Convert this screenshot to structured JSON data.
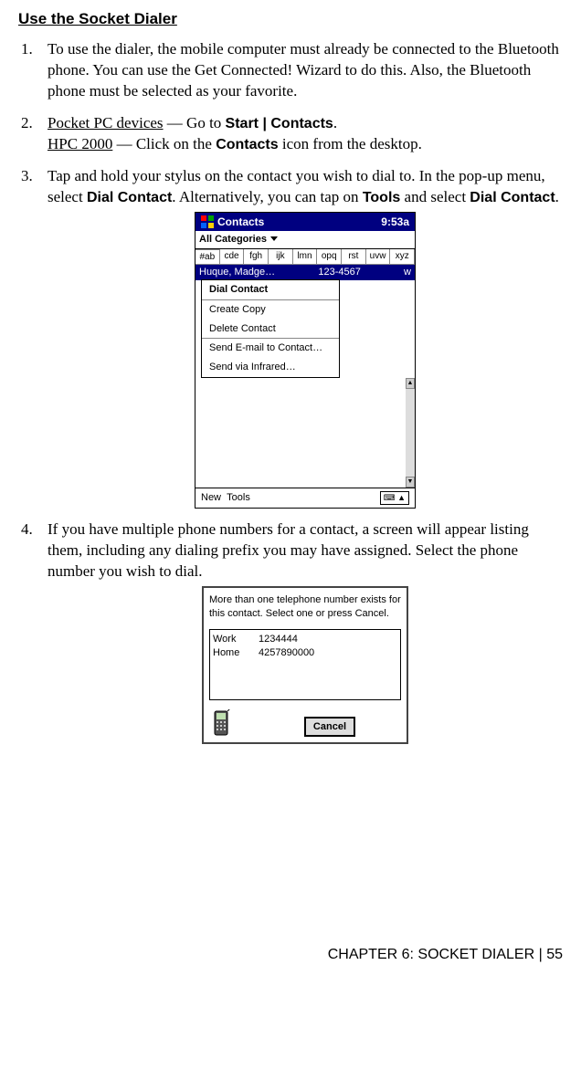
{
  "section_title": "Use the Socket Dialer",
  "steps": {
    "s1": "To use the dialer, the mobile computer must already be connected to the Bluetooth phone. You can use the Get Connected! Wizard to do this. Also, the Bluetooth phone must be selected as your favorite.",
    "s2": {
      "ppc_label": "Pocket PC devices",
      "ppc_text_1": " — Go to ",
      "ppc_bold": "Start | Contacts",
      "ppc_text_2": ".",
      "hpc_label": "HPC 2000",
      "hpc_text_1": " — Click on the ",
      "hpc_bold": "Contacts",
      "hpc_text_2": " icon from the desktop."
    },
    "s3": {
      "text_1": "Tap and hold your stylus on the contact you wish to dial to. In the pop-up menu, select ",
      "bold_1": "Dial Contact",
      "text_2": ". Alternatively, you can tap on ",
      "bold_2": "Tools",
      "text_3": " and select ",
      "bold_3": "Dial Contact",
      "text_4": "."
    },
    "s4": "If you have multiple phone numbers for a contact, a screen will appear listing them, including any dialing prefix you may have assigned. Select the phone number you wish to dial."
  },
  "screenshot1": {
    "title_app": "Contacts",
    "title_time": "9:53a",
    "cat_label": "All Categories",
    "alpha_tabs": [
      "#ab",
      "cde",
      "fgh",
      "ijk",
      "lmn",
      "opq",
      "rst",
      "uvw",
      "xyz"
    ],
    "contact_name": "Huque, Madge…",
    "contact_num": "123-4567",
    "contact_type": "w",
    "menu": {
      "dial": "Dial Contact",
      "copy": "Create Copy",
      "delete": "Delete Contact",
      "email": "Send E-mail to Contact…",
      "ir": "Send via Infrared…"
    },
    "bottom_new": "New",
    "bottom_tools": "Tools"
  },
  "screenshot2": {
    "message": "More than one telephone number exists for this contact.  Select one or press Cancel.",
    "numbers": [
      {
        "label": "Work",
        "value": "1234444"
      },
      {
        "label": "Home",
        "value": "4257890000"
      }
    ],
    "cancel": "Cancel"
  },
  "footer": "CHAPTER 6: SOCKET DIALER | 55"
}
